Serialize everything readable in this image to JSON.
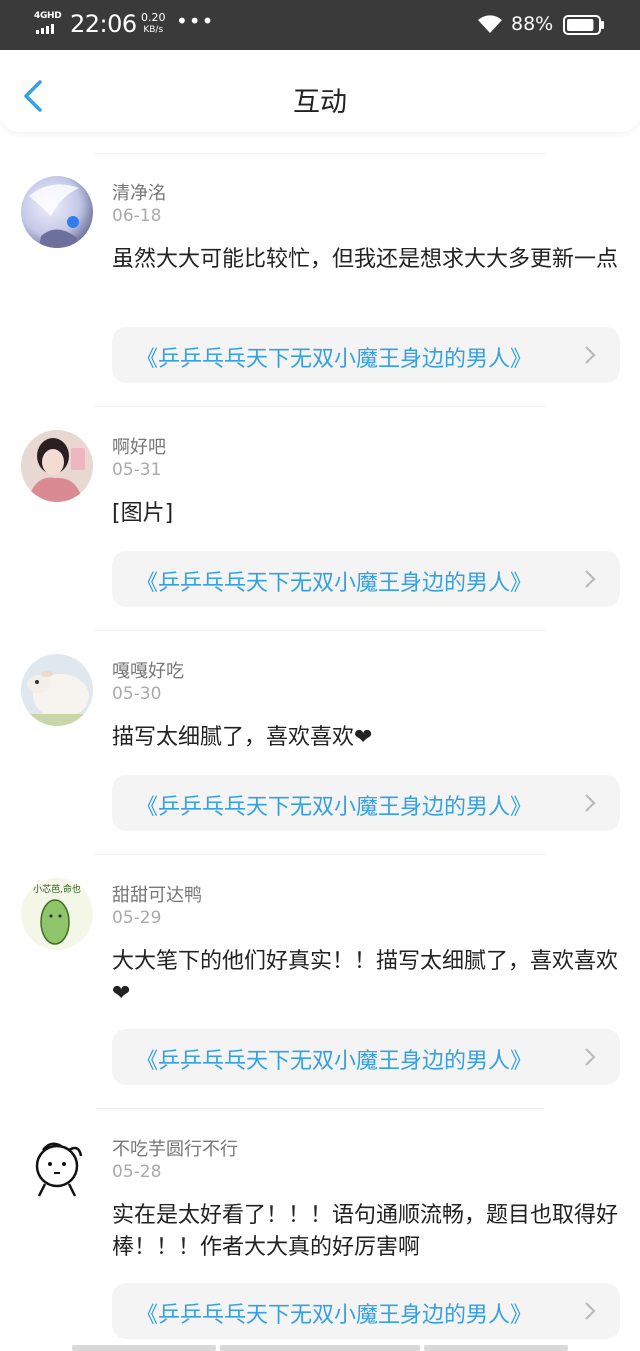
{
  "status_bar": {
    "network": "4GHD",
    "time": "22:06",
    "speed_value": "0.20",
    "speed_unit": "KB/s",
    "more": "•••",
    "battery": "88%",
    "battery_level": 0.88
  },
  "header": {
    "title": "互动",
    "back_icon": "chevron-left-icon",
    "accent_color": "#36a0e0"
  },
  "comments": [
    {
      "username": "清净洺",
      "date": "06-18",
      "text": "虽然大大可能比较忙，但我还是想求大大多更新一点",
      "book": "《乒乒乓乓天下无双小魔王身边的男人》"
    },
    {
      "username": "啊好吧",
      "date": "05-31",
      "text": "[图片]",
      "book": "《乒乒乓乓天下无双小魔王身边的男人》"
    },
    {
      "username": "嘎嘎好吃",
      "date": "05-30",
      "text": "描写太细腻了，喜欢喜欢❤",
      "book": "《乒乒乓乓天下无双小魔王身边的男人》"
    },
    {
      "username": "甜甜可达鸭",
      "date": "05-29",
      "text": "大大笔下的他们好真实！！描写太细腻了，喜欢喜欢❤",
      "book": "《乒乒乓乓天下无双小魔王身边的男人》"
    },
    {
      "username": "不吃芋圆行不行",
      "date": "05-28",
      "text": "实在是太好看了！！！语句通顺流畅，题目也取得好棒！！！作者大大真的好厉害啊",
      "book": "《乒乒乓乓天下无双小魔王身边的男人》"
    }
  ],
  "avatars": {
    "4": {
      "caption": "小芯芭,命也"
    }
  }
}
